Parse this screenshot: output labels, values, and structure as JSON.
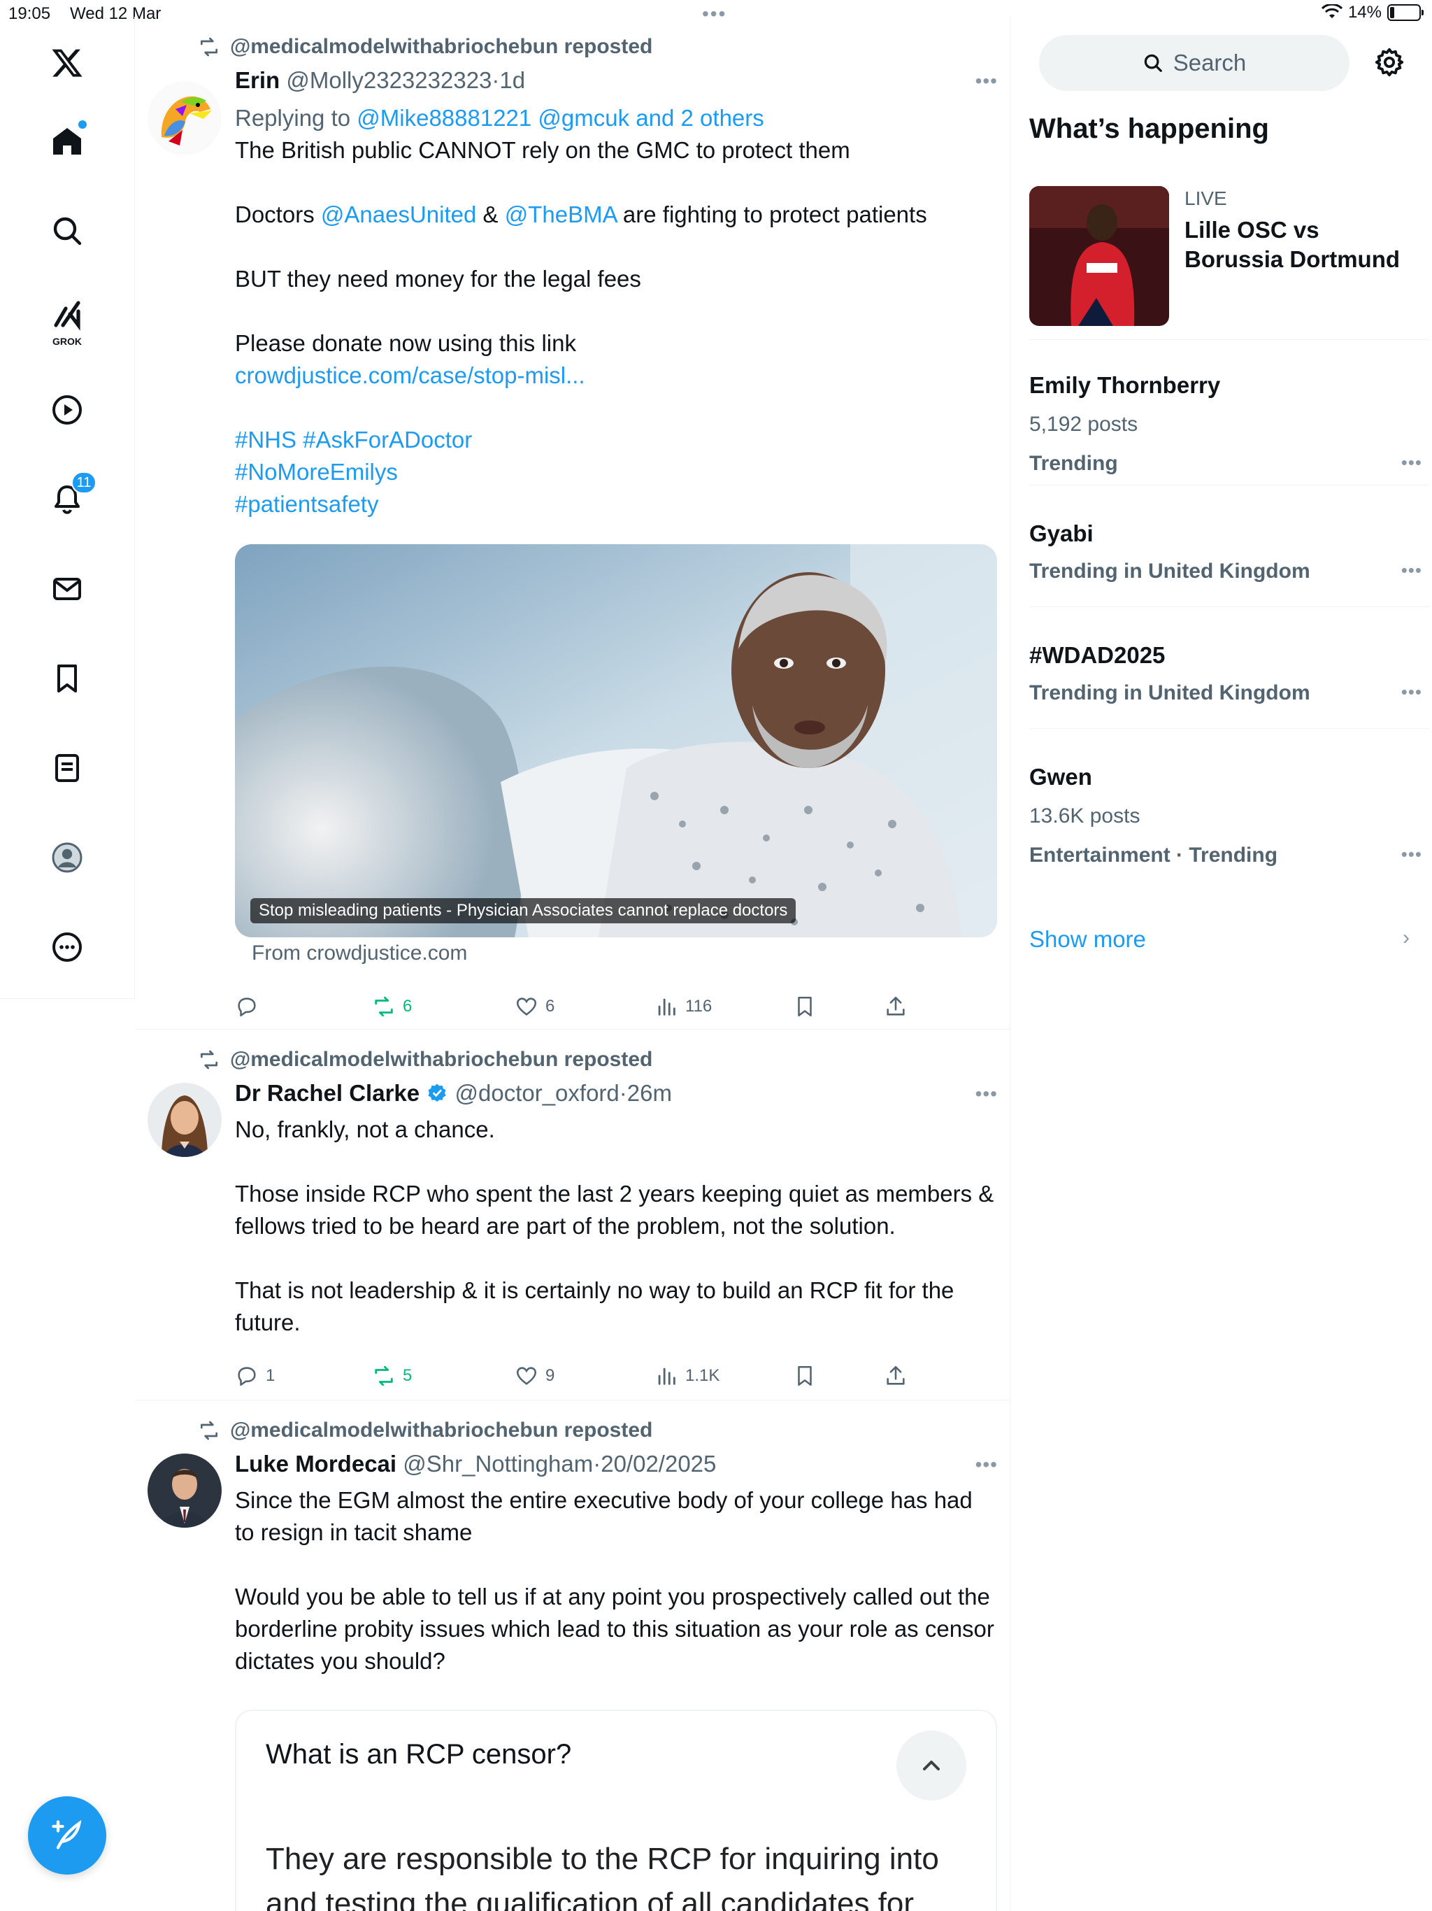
{
  "status_bar": {
    "time": "19:05",
    "date": "Wed 12 Mar",
    "dots": "•••",
    "battery": "14%",
    "battery_level": 0.14
  },
  "nav": {
    "notifications_badge": "11",
    "grok_label": "GROK"
  },
  "posts": [
    {
      "repost_by": "@medicalmodelwithabriochebun reposted",
      "name": "Erin",
      "handle": "@Molly2323232323",
      "sep": "·",
      "time": "1d",
      "replying_prefix": "Replying to ",
      "replying_mentions": "@Mike88881221 @gmcuk and 2 others",
      "line1": "The British public CANNOT rely on the GMC to protect them",
      "line2_a": "Doctors ",
      "line2_m1": "@AnaesUnited",
      "line2_b": " & ",
      "line2_m2": "@TheBMA",
      "line2_c": " are fighting to protect patients",
      "line3": "BUT they need money for the legal fees",
      "line4": "Please donate now using this link",
      "link": "crowdjustice.com/case/stop-misl...",
      "hashtags_1": "#NHS #AskForADoctor",
      "hashtags_2": "#NoMoreEmilys",
      "hashtags_3": "#patientsafety",
      "media_caption": "Stop misleading patients - Physician Associates cannot replace doctors",
      "from": "From crowdjustice.com",
      "replies": "",
      "reposts": "6",
      "likes": "6",
      "views": "116"
    },
    {
      "repost_by": "@medicalmodelwithabriochebun reposted",
      "name": "Dr Rachel Clarke",
      "handle": "@doctor_oxford",
      "sep": "·",
      "time": "26m",
      "p1": "No, frankly, not a chance.",
      "p2": "Those inside RCP who spent the last 2 years keeping quiet as members & fellows tried to be heard are part of the problem, not the solution.",
      "p3": "That is not leadership & it is certainly no way to build an RCP fit for the future.",
      "replies": "1",
      "reposts": "5",
      "likes": "9",
      "views": "1.1K"
    },
    {
      "repost_by": "@medicalmodelwithabriochebun reposted",
      "name": "Luke Mordecai",
      "handle": "@Shr_Nottingham",
      "sep": "·",
      "time": "20/02/2025",
      "p1": "Since the EGM almost the entire executive body of your college has had to resign in tacit shame",
      "p2": "Would you be able to tell us if at any point you prospectively called out the borderline probity issues which lead to this situation as your role as censor dictates you should?",
      "card_title": "What is an RCP censor?",
      "card_body": "They are responsible to the RCP for inquiring into and testing the qualification of all candidates for"
    }
  ],
  "sidebar": {
    "search_placeholder": "Search",
    "whats_happening": "What’s happening",
    "live": {
      "label": "LIVE",
      "title": "Lille OSC vs Borussia Dortmund"
    },
    "trends": [
      {
        "title": "Emily Thornberry",
        "posts": "5,192 posts",
        "context": "Trending"
      },
      {
        "title": "Gyabi",
        "context": "Trending in United Kingdom"
      },
      {
        "title": "#WDAD2025",
        "context": "Trending in United Kingdom"
      },
      {
        "title": "Gwen",
        "posts": "13.6K posts",
        "context": "Entertainment · Trending"
      }
    ],
    "show_more": "Show more"
  },
  "colors": {
    "accent": "#1d9bf0",
    "repost_green": "#00ba7c",
    "text": "#0f1419",
    "muted": "#536471"
  }
}
